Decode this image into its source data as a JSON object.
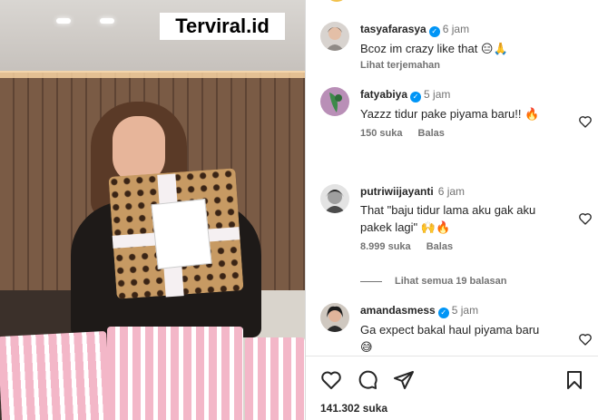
{
  "media": {
    "watermark": "Terviral.id"
  },
  "comments": [
    {
      "username": "tasyafarasya",
      "verified": true,
      "time": "6 jam",
      "text": "Bcoz im crazy like that 😑🙏",
      "translate_label": "Lihat terjemahan"
    },
    {
      "username": "fatyabiya",
      "verified": true,
      "time": "5 jam",
      "text": "Yazzz tidur pake piyama baru!! 🔥",
      "likes": "150 suka",
      "reply_label": "Balas"
    },
    {
      "username": "putriwiijayanti",
      "verified": false,
      "time": "6 jam",
      "text": "That \"baju tidur lama aku gak aku pakek lagi\" 🙌🔥",
      "likes": "8.999 suka",
      "reply_label": "Balas"
    },
    {
      "username": "amandasmess",
      "verified": true,
      "time": "5 jam",
      "text": "Ga expect bakal haul piyama baru😅"
    }
  ],
  "view_replies_label": "Lihat semua 19 balasan",
  "actions": {
    "like_icon": "heart-icon",
    "comment_icon": "comment-icon",
    "share_icon": "share-icon",
    "save_icon": "bookmark-icon"
  },
  "post_likes": "141.302 suka",
  "colors": {
    "verified": "#0095f6",
    "text": "#262626",
    "muted": "#737373"
  }
}
